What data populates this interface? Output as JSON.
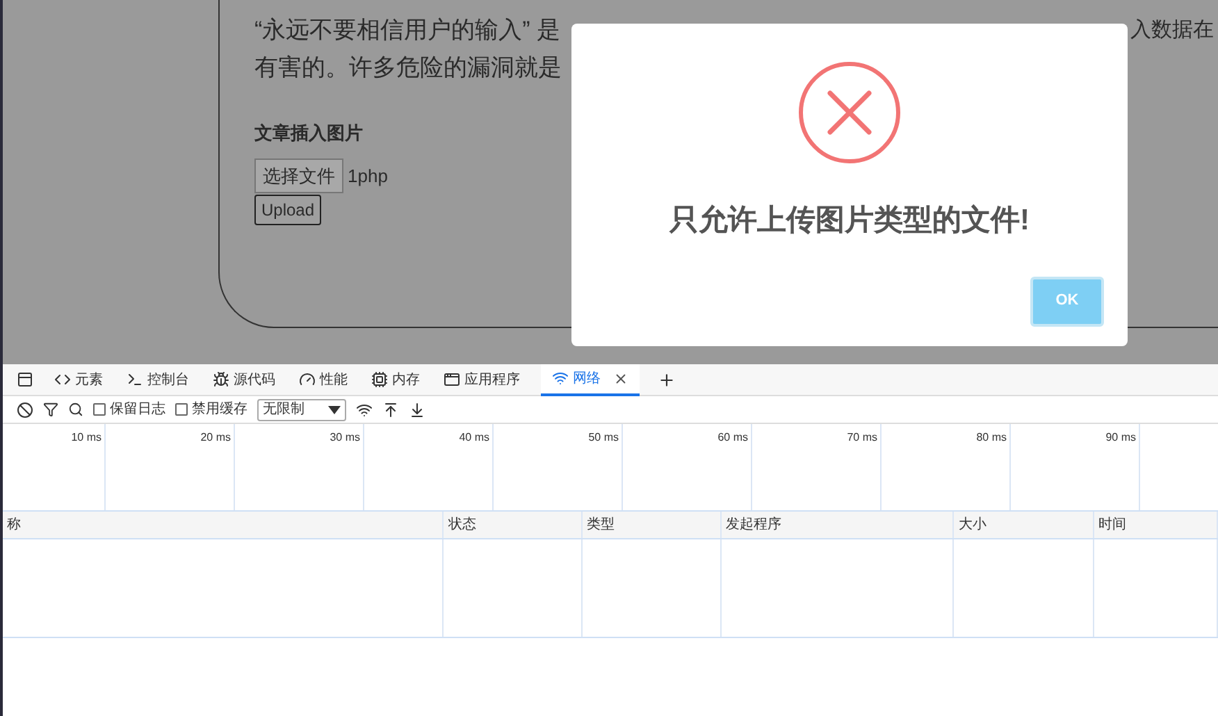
{
  "page": {
    "paragraph_line_1_left": "“永远不要相信用户的输入” 是",
    "paragraph_line_1_right": "入数据在",
    "paragraph_line_2_left": "有害的。许多危险的漏洞就是",
    "section_title": "文章插入图片",
    "choose_file_button": "选择文件",
    "file_name": "1php",
    "upload_button": "Upload"
  },
  "dialog": {
    "message": "只允许上传图片类型的文件!",
    "ok_button": "OK"
  },
  "devtools": {
    "tabs": [
      {
        "label": "元素",
        "selected": false
      },
      {
        "label": "控制台",
        "selected": false
      },
      {
        "label": "源代码",
        "selected": false
      },
      {
        "label": "性能",
        "selected": false
      },
      {
        "label": "内存",
        "selected": false
      },
      {
        "label": "应用程序",
        "selected": false
      },
      {
        "label": "网络",
        "selected": true
      }
    ],
    "toolbar": {
      "preserve_log": {
        "label": "保留日志",
        "checked": false
      },
      "disable_cache": {
        "label": "禁用缓存",
        "checked": false
      },
      "throttling": "无限制"
    },
    "timeline_ticks": [
      "10 ms",
      "20 ms",
      "30 ms",
      "40 ms",
      "50 ms",
      "60 ms",
      "70 ms",
      "80 ms",
      "90 ms"
    ],
    "table": {
      "columns": [
        "称",
        "状态",
        "类型",
        "发起程序",
        "大小",
        "时间"
      ]
    }
  }
}
